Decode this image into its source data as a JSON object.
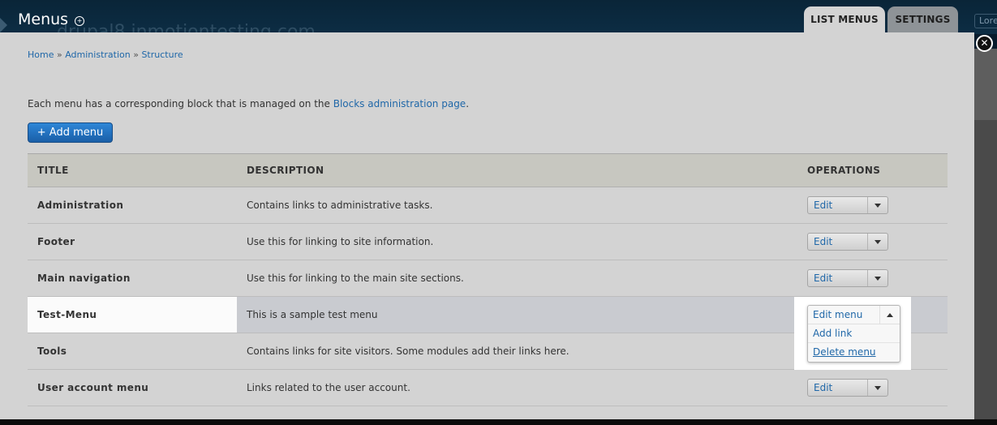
{
  "header": {
    "title": "Menus",
    "background_site_text": "drupal8.inmotiontesting.com",
    "tabs": [
      {
        "label": "LIST MENUS",
        "active": true
      },
      {
        "label": "SETTINGS",
        "active": false
      }
    ],
    "right_button_text": "Lore"
  },
  "breadcrumb": {
    "items": [
      "Home",
      "Administration",
      "Structure"
    ],
    "separator": "»"
  },
  "intro": {
    "text_before": "Each menu has a corresponding block that is managed on the ",
    "link_text": "Blocks administration page",
    "text_after": "."
  },
  "add_button_label": "+ Add menu",
  "table": {
    "headers": [
      "TITLE",
      "DESCRIPTION",
      "OPERATIONS"
    ],
    "rows": [
      {
        "title": "Administration",
        "description": "Contains links to administrative tasks.",
        "operation": "Edit menu"
      },
      {
        "title": "Footer",
        "description": "Use this for linking to site information.",
        "operation": "Edit menu"
      },
      {
        "title": "Main navigation",
        "description": "Use this for linking to the main site sections.",
        "operation": "Edit menu"
      },
      {
        "title": "Test-Menu",
        "description": "This is a sample test menu",
        "operation": "Edit menu"
      },
      {
        "title": "Tools",
        "description": "Contains links for site visitors. Some modules add their links here.",
        "operation": ""
      },
      {
        "title": "User account menu",
        "description": "Links related to the user account.",
        "operation": "Edit menu"
      }
    ]
  },
  "dropdown_open": {
    "items": [
      "Edit menu",
      "Add link",
      "Delete menu"
    ]
  },
  "close_symbol": "✕",
  "colors": {
    "link": "#1f67a8",
    "primary_button": "#2d86d7",
    "header_bg": "#0c2d44",
    "overlay_bg": "#d3d3d3"
  }
}
